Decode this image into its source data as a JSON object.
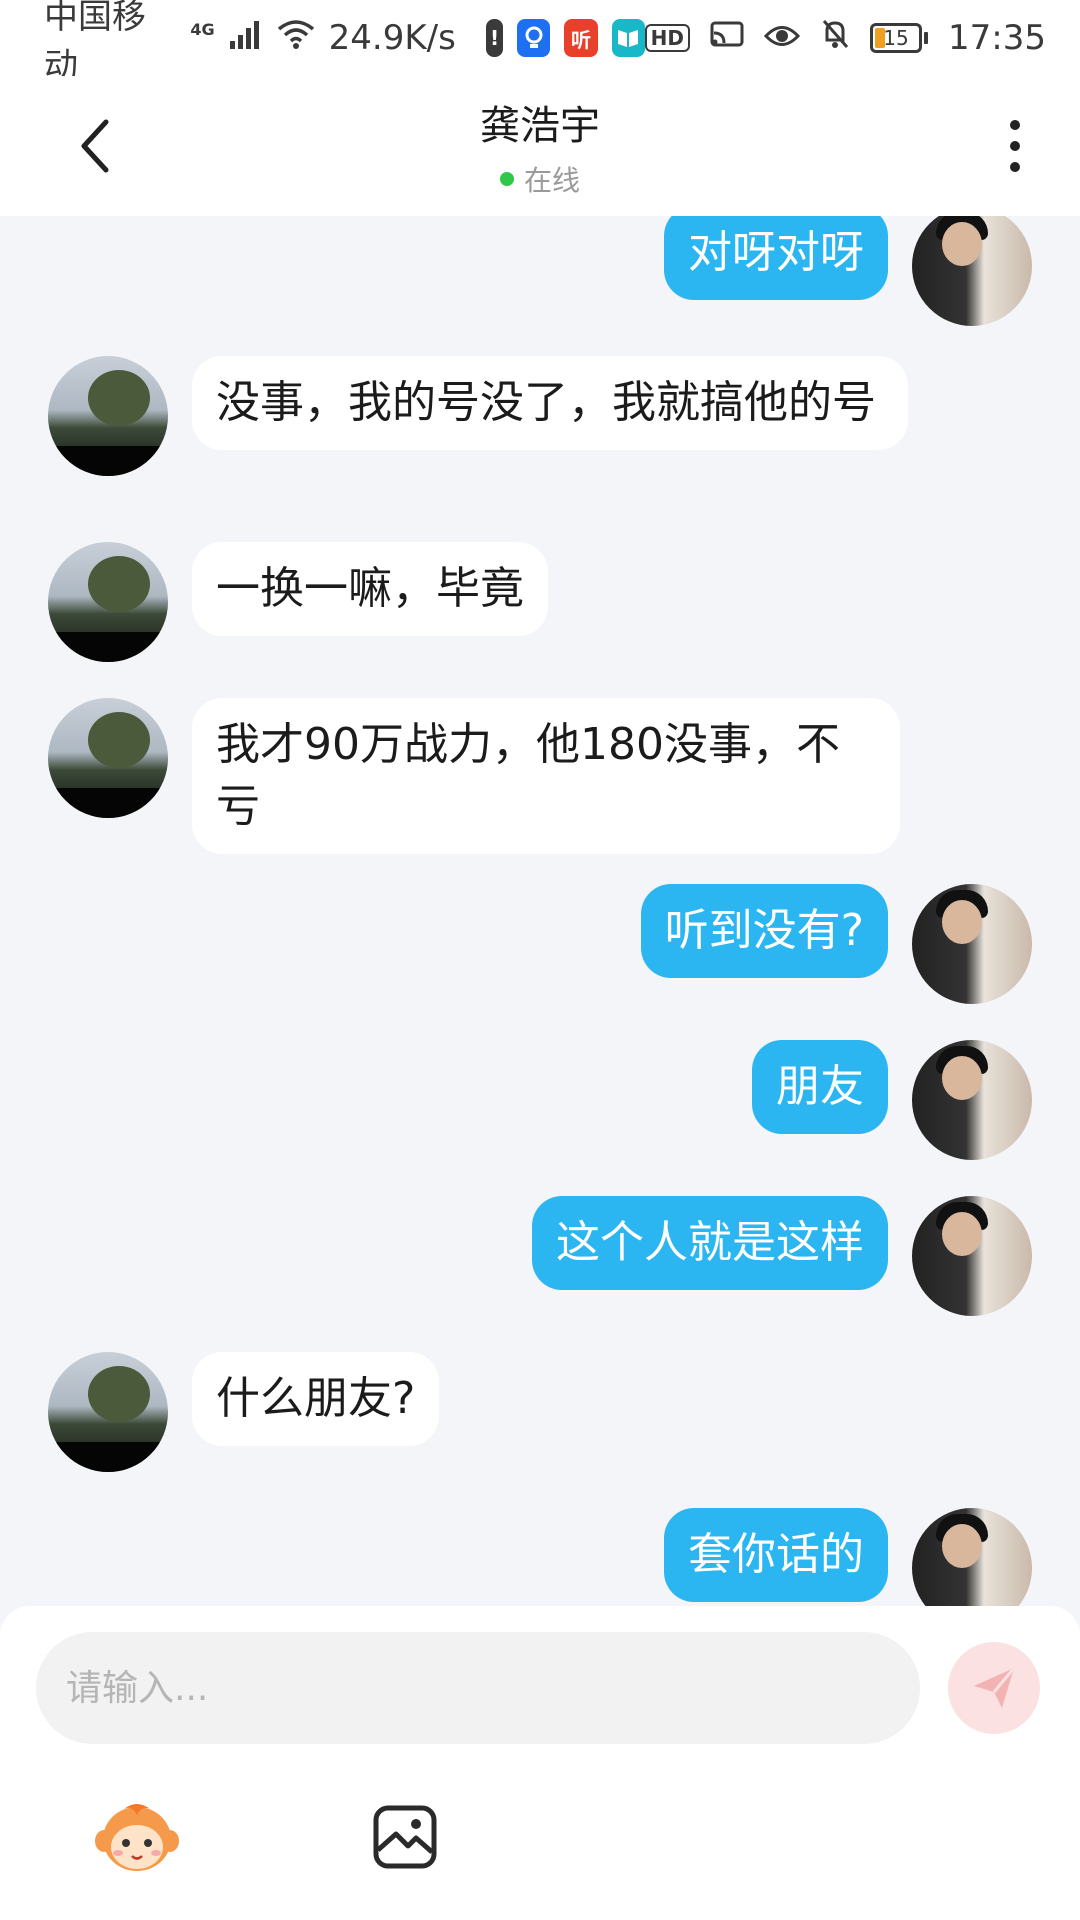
{
  "status_bar": {
    "carrier": "中国移动",
    "network": "4G",
    "speed": "24.9K/s",
    "battery": "15",
    "time": "17:35",
    "hd_label": "HD",
    "listen_app_label": "听"
  },
  "header": {
    "title": "龚浩宇",
    "status": "在线"
  },
  "messages": [
    {
      "side": "right",
      "text": "对呀对呀"
    },
    {
      "side": "left",
      "text": "没事，我的号没了，我就搞他的号"
    },
    {
      "side": "left",
      "text": "一换一嘛，毕竟"
    },
    {
      "side": "left",
      "text": "我才90万战力，他180没事，不亏"
    },
    {
      "side": "right",
      "text": "听到没有?"
    },
    {
      "side": "right",
      "text": "朋友"
    },
    {
      "side": "right",
      "text": "这个人就是这样"
    },
    {
      "side": "left",
      "text": "什么朋友?"
    },
    {
      "side": "right",
      "text": "套你话的"
    }
  ],
  "input": {
    "placeholder": "请输入...",
    "value": ""
  },
  "toolbar": {
    "emoji_icon": "monkey-face-icon",
    "image_icon": "image-icon",
    "send_icon": "paper-plane-icon"
  },
  "colors": {
    "my_bubble": "#2bb6f2",
    "their_bubble": "#ffffff",
    "background": "#f3f5f9",
    "online": "#2fc84a",
    "send_button": "#fbe1e1"
  }
}
